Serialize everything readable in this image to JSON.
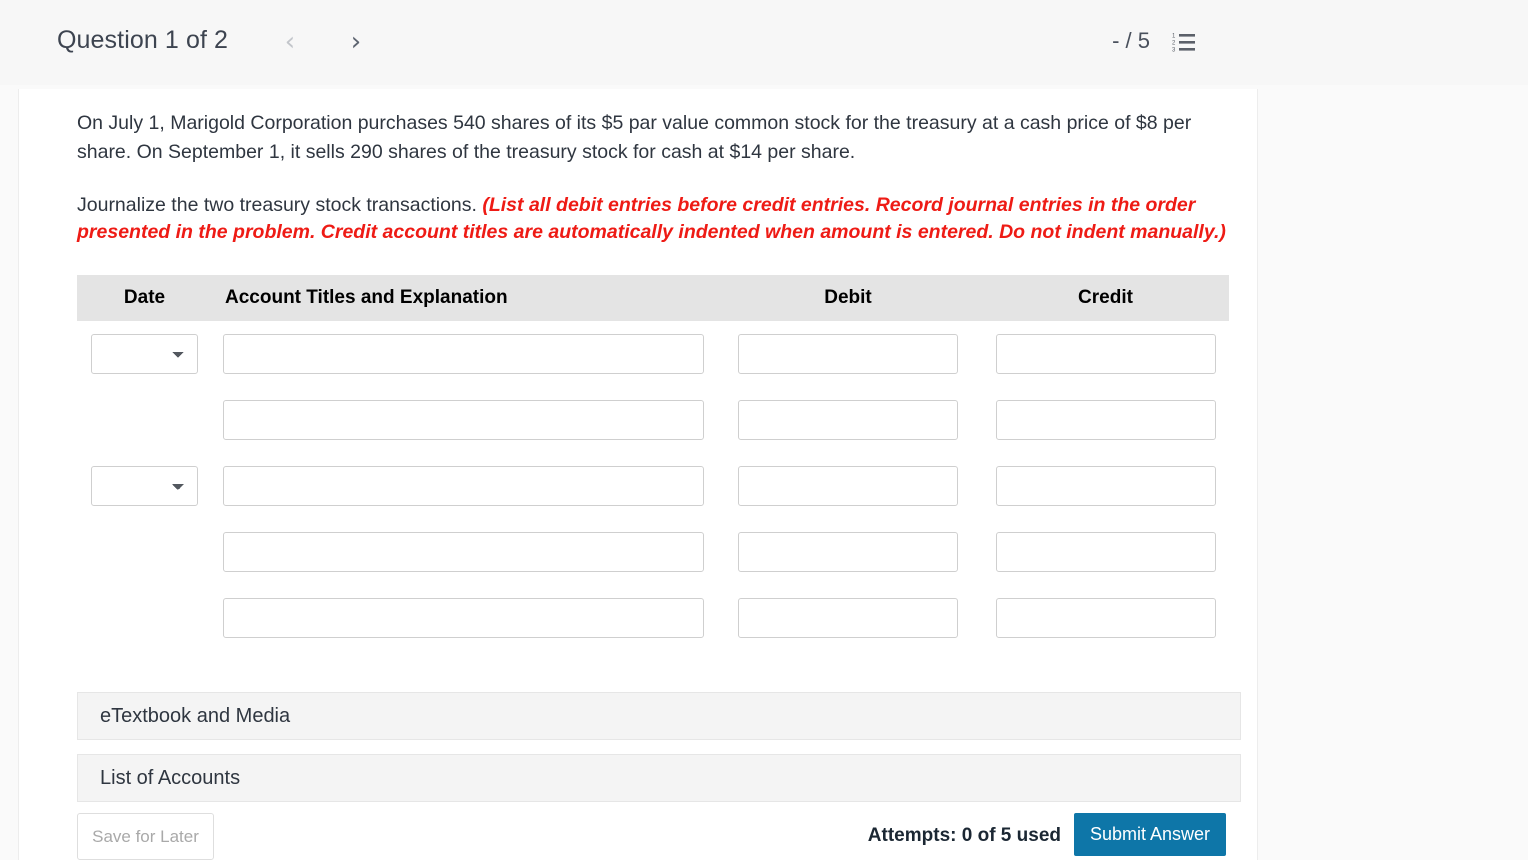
{
  "header": {
    "question_label": "Question 1 of 2",
    "prev_icon": "chevron-left-icon",
    "next_icon": "chevron-right-icon",
    "score": "- / 5",
    "list_icon": "numbered-list-icon",
    "menu_icon": "kebab-menu-icon"
  },
  "question": {
    "paragraph1": "On July 1, Marigold Corporation purchases 540 shares of its $5 par value common stock for the treasury at a cash price of $8 per share. On September 1, it sells 290 shares of the treasury stock for cash at $14 per share.",
    "paragraph2_lead": "Journalize the two treasury stock transactions. ",
    "paragraph2_note": "(List all debit entries before credit entries. Record journal entries in the order presented in the problem. Credit account titles are automatically indented when amount is entered. Do not indent manually.)"
  },
  "table": {
    "headers": {
      "date": "Date",
      "account": "Account Titles and Explanation",
      "debit": "Debit",
      "credit": "Credit"
    },
    "rows": [
      {
        "has_date_select": true,
        "date_value": "",
        "account": "",
        "debit": "",
        "credit": ""
      },
      {
        "has_date_select": false,
        "date_value": "",
        "account": "",
        "debit": "",
        "credit": ""
      },
      {
        "has_date_select": true,
        "date_value": "",
        "account": "",
        "debit": "",
        "credit": ""
      },
      {
        "has_date_select": false,
        "date_value": "",
        "account": "",
        "debit": "",
        "credit": ""
      },
      {
        "has_date_select": false,
        "date_value": "",
        "account": "",
        "debit": "",
        "credit": ""
      }
    ]
  },
  "panels": {
    "etextbook": "eTextbook and Media",
    "accounts": "List of Accounts"
  },
  "footer": {
    "save_label": "Save for Later",
    "attempts": "Attempts: 0 of 5 used",
    "submit_label": "Submit Answer",
    "submit_color": "#0e76a8"
  }
}
